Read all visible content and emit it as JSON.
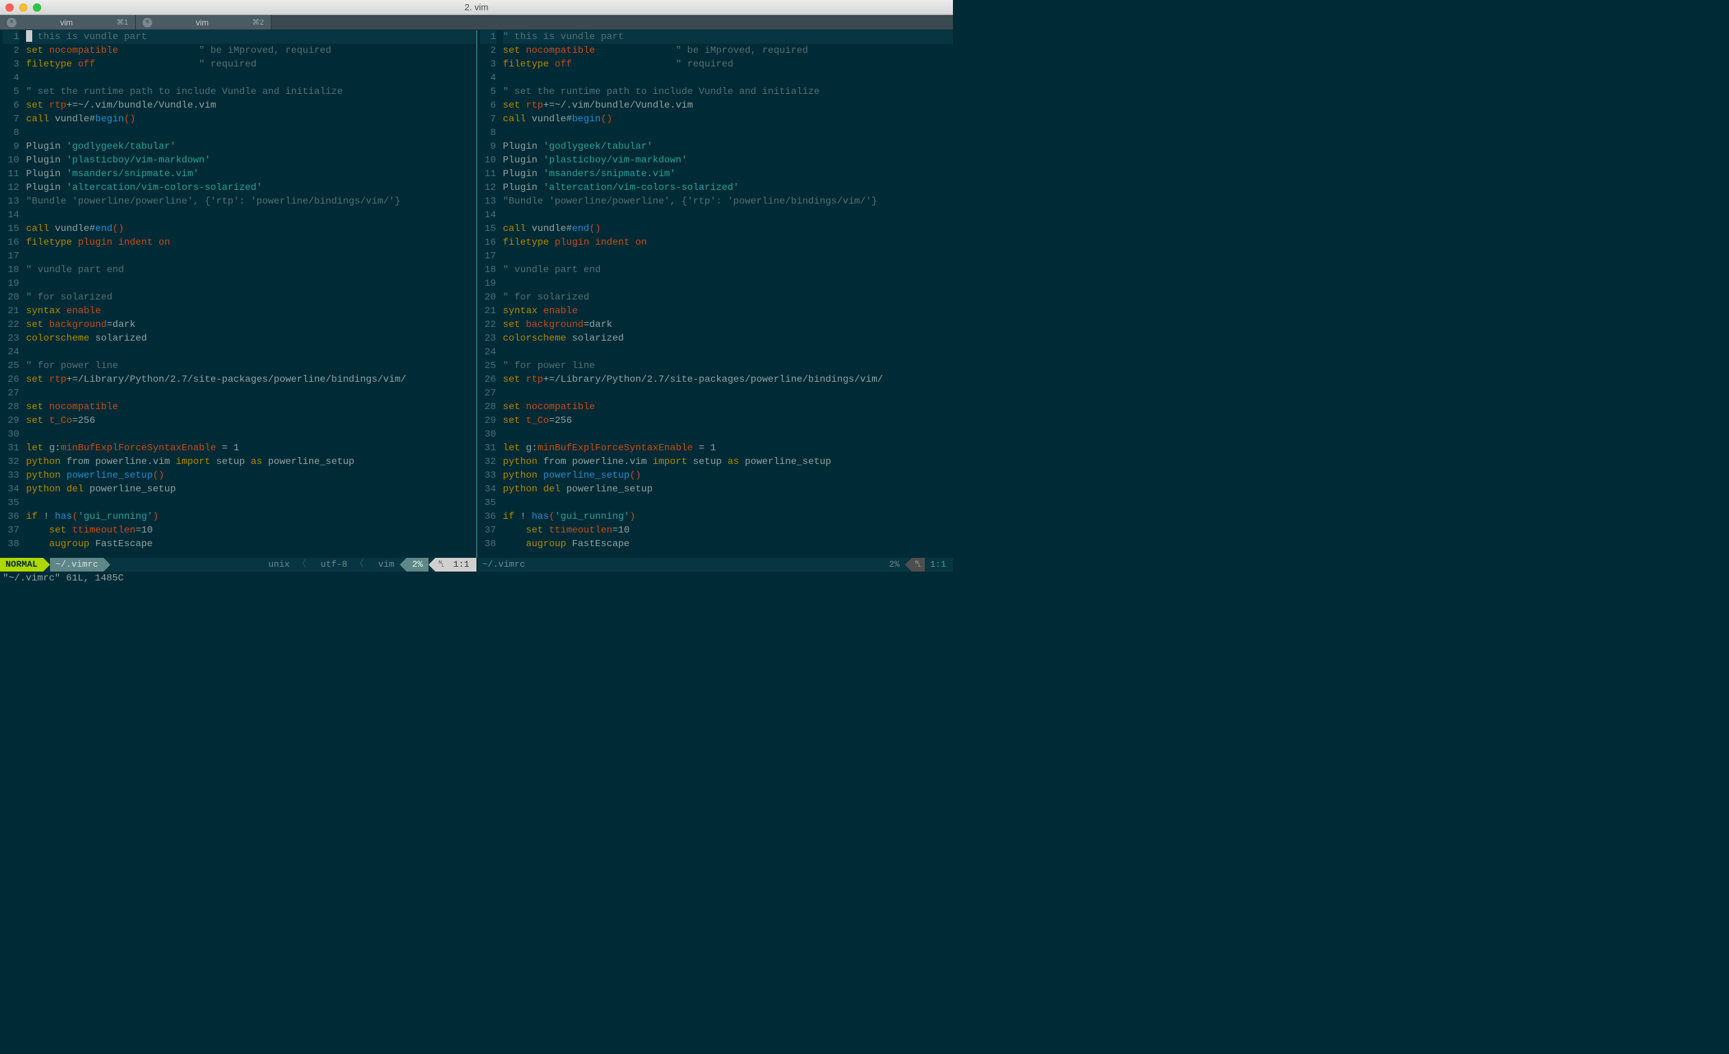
{
  "window": {
    "title": "2. vim"
  },
  "tabs": [
    {
      "title": "vim",
      "shortcut": "⌘1"
    },
    {
      "title": "vim",
      "shortcut": "⌘2"
    }
  ],
  "code_lines": [
    {
      "n": 1,
      "tokens": [
        [
          "c-comment",
          "\" this is vundle part"
        ]
      ],
      "cursor": true
    },
    {
      "n": 2,
      "tokens": [
        [
          "c-keyword",
          "set"
        ],
        [
          "c-normal",
          " "
        ],
        [
          "c-ident",
          "nocompatible"
        ],
        [
          "c-normal",
          "              "
        ],
        [
          "c-comment",
          "\" be iMproved, required"
        ]
      ]
    },
    {
      "n": 3,
      "tokens": [
        [
          "c-keyword",
          "filetype"
        ],
        [
          "c-normal",
          " "
        ],
        [
          "c-ident",
          "off"
        ],
        [
          "c-normal",
          "                  "
        ],
        [
          "c-comment",
          "\" required"
        ]
      ]
    },
    {
      "n": 4,
      "tokens": []
    },
    {
      "n": 5,
      "tokens": [
        [
          "c-comment",
          "\" set the runtime path to include Vundle and initialize"
        ]
      ]
    },
    {
      "n": 6,
      "tokens": [
        [
          "c-keyword",
          "set"
        ],
        [
          "c-normal",
          " "
        ],
        [
          "c-ident",
          "rtp"
        ],
        [
          "c-normal",
          "+=~/.vim/bundle/Vundle.vim"
        ]
      ]
    },
    {
      "n": 7,
      "tokens": [
        [
          "c-keyword",
          "call"
        ],
        [
          "c-normal",
          " vundle#"
        ],
        [
          "c-func",
          "begin"
        ],
        [
          "c-symbol",
          "()"
        ]
      ]
    },
    {
      "n": 8,
      "tokens": []
    },
    {
      "n": 9,
      "tokens": [
        [
          "c-normal",
          "Plugin "
        ],
        [
          "c-string",
          "'godlygeek/tabular'"
        ]
      ]
    },
    {
      "n": 10,
      "tokens": [
        [
          "c-normal",
          "Plugin "
        ],
        [
          "c-string",
          "'plasticboy/vim-markdown'"
        ]
      ]
    },
    {
      "n": 11,
      "tokens": [
        [
          "c-normal",
          "Plugin "
        ],
        [
          "c-string",
          "'msanders/snipmate.vim'"
        ]
      ]
    },
    {
      "n": 12,
      "tokens": [
        [
          "c-normal",
          "Plugin "
        ],
        [
          "c-string",
          "'altercation/vim-colors-solarized'"
        ]
      ]
    },
    {
      "n": 13,
      "tokens": [
        [
          "c-comment",
          "\"Bundle 'powerline/powerline', {'rtp': 'powerline/bindings/vim/'}"
        ]
      ]
    },
    {
      "n": 14,
      "tokens": []
    },
    {
      "n": 15,
      "tokens": [
        [
          "c-keyword",
          "call"
        ],
        [
          "c-normal",
          " vundle#"
        ],
        [
          "c-func",
          "end"
        ],
        [
          "c-symbol",
          "()"
        ]
      ]
    },
    {
      "n": 16,
      "tokens": [
        [
          "c-keyword",
          "filetype"
        ],
        [
          "c-normal",
          " "
        ],
        [
          "c-ident",
          "plugin"
        ],
        [
          "c-normal",
          " "
        ],
        [
          "c-ident",
          "indent"
        ],
        [
          "c-normal",
          " "
        ],
        [
          "c-ident",
          "on"
        ]
      ]
    },
    {
      "n": 17,
      "tokens": []
    },
    {
      "n": 18,
      "tokens": [
        [
          "c-comment",
          "\" vundle part end"
        ]
      ]
    },
    {
      "n": 19,
      "tokens": []
    },
    {
      "n": 20,
      "tokens": [
        [
          "c-comment",
          "\" for solarized"
        ]
      ]
    },
    {
      "n": 21,
      "tokens": [
        [
          "c-keyword",
          "syntax"
        ],
        [
          "c-normal",
          " "
        ],
        [
          "c-ident",
          "enable"
        ]
      ]
    },
    {
      "n": 22,
      "tokens": [
        [
          "c-keyword",
          "set"
        ],
        [
          "c-normal",
          " "
        ],
        [
          "c-ident",
          "background"
        ],
        [
          "c-normal",
          "=dark"
        ]
      ]
    },
    {
      "n": 23,
      "tokens": [
        [
          "c-keyword",
          "colorscheme"
        ],
        [
          "c-normal",
          " solarized"
        ]
      ]
    },
    {
      "n": 24,
      "tokens": []
    },
    {
      "n": 25,
      "tokens": [
        [
          "c-comment",
          "\" for power line"
        ]
      ]
    },
    {
      "n": 26,
      "tokens": [
        [
          "c-keyword",
          "set"
        ],
        [
          "c-normal",
          " "
        ],
        [
          "c-ident",
          "rtp"
        ],
        [
          "c-normal",
          "+=/Library/Python/2.7/site-packages/powerline/bindings/vim/"
        ]
      ]
    },
    {
      "n": 27,
      "tokens": []
    },
    {
      "n": 28,
      "tokens": [
        [
          "c-keyword",
          "set"
        ],
        [
          "c-normal",
          " "
        ],
        [
          "c-ident",
          "nocompatible"
        ]
      ]
    },
    {
      "n": 29,
      "tokens": [
        [
          "c-keyword",
          "set"
        ],
        [
          "c-normal",
          " "
        ],
        [
          "c-ident",
          "t_Co"
        ],
        [
          "c-normal",
          "=256"
        ]
      ]
    },
    {
      "n": 30,
      "tokens": []
    },
    {
      "n": 31,
      "tokens": [
        [
          "c-keyword",
          "let"
        ],
        [
          "c-normal",
          " g:"
        ],
        [
          "c-ident",
          "minBufExplForceSyntaxEnable"
        ],
        [
          "c-normal",
          " = 1"
        ]
      ]
    },
    {
      "n": 32,
      "tokens": [
        [
          "c-keyword",
          "python"
        ],
        [
          "c-normal",
          " from powerline.vim "
        ],
        [
          "c-keyword",
          "import"
        ],
        [
          "c-normal",
          " setup "
        ],
        [
          "c-keyword",
          "as"
        ],
        [
          "c-normal",
          " powerline_setup"
        ]
      ]
    },
    {
      "n": 33,
      "tokens": [
        [
          "c-keyword",
          "python"
        ],
        [
          "c-normal",
          " "
        ],
        [
          "c-func",
          "powerline_setup"
        ],
        [
          "c-symbol",
          "()"
        ]
      ]
    },
    {
      "n": 34,
      "tokens": [
        [
          "c-keyword",
          "python"
        ],
        [
          "c-normal",
          " "
        ],
        [
          "c-keyword",
          "del"
        ],
        [
          "c-normal",
          " powerline_setup"
        ]
      ]
    },
    {
      "n": 35,
      "tokens": []
    },
    {
      "n": 36,
      "tokens": [
        [
          "c-keyword",
          "if"
        ],
        [
          "c-normal",
          " ! "
        ],
        [
          "c-func",
          "has"
        ],
        [
          "c-symbol",
          "("
        ],
        [
          "c-string",
          "'gui_running'"
        ],
        [
          "c-symbol",
          ")"
        ]
      ]
    },
    {
      "n": 37,
      "tokens": [
        [
          "c-normal",
          "    "
        ],
        [
          "c-keyword",
          "set"
        ],
        [
          "c-normal",
          " "
        ],
        [
          "c-ident",
          "ttimeoutlen"
        ],
        [
          "c-normal",
          "=10"
        ]
      ]
    },
    {
      "n": 38,
      "tokens": [
        [
          "c-normal",
          "    "
        ],
        [
          "c-keyword",
          "augroup"
        ],
        [
          "c-normal",
          " FastEscape"
        ]
      ]
    }
  ],
  "status_left": {
    "mode": "NORMAL",
    "file": "~/.vimrc",
    "format": "unix",
    "encoding": "utf-8",
    "filetype": "vim",
    "percent": "2%",
    "ln_icon": "␤",
    "position": "1:1"
  },
  "status_right": {
    "file": "~/.vimrc",
    "percent": "2%",
    "ln_icon": "␤",
    "line": "1",
    "col": ":1"
  },
  "cmdline": "\"~/.vimrc\" 61L, 1485C"
}
